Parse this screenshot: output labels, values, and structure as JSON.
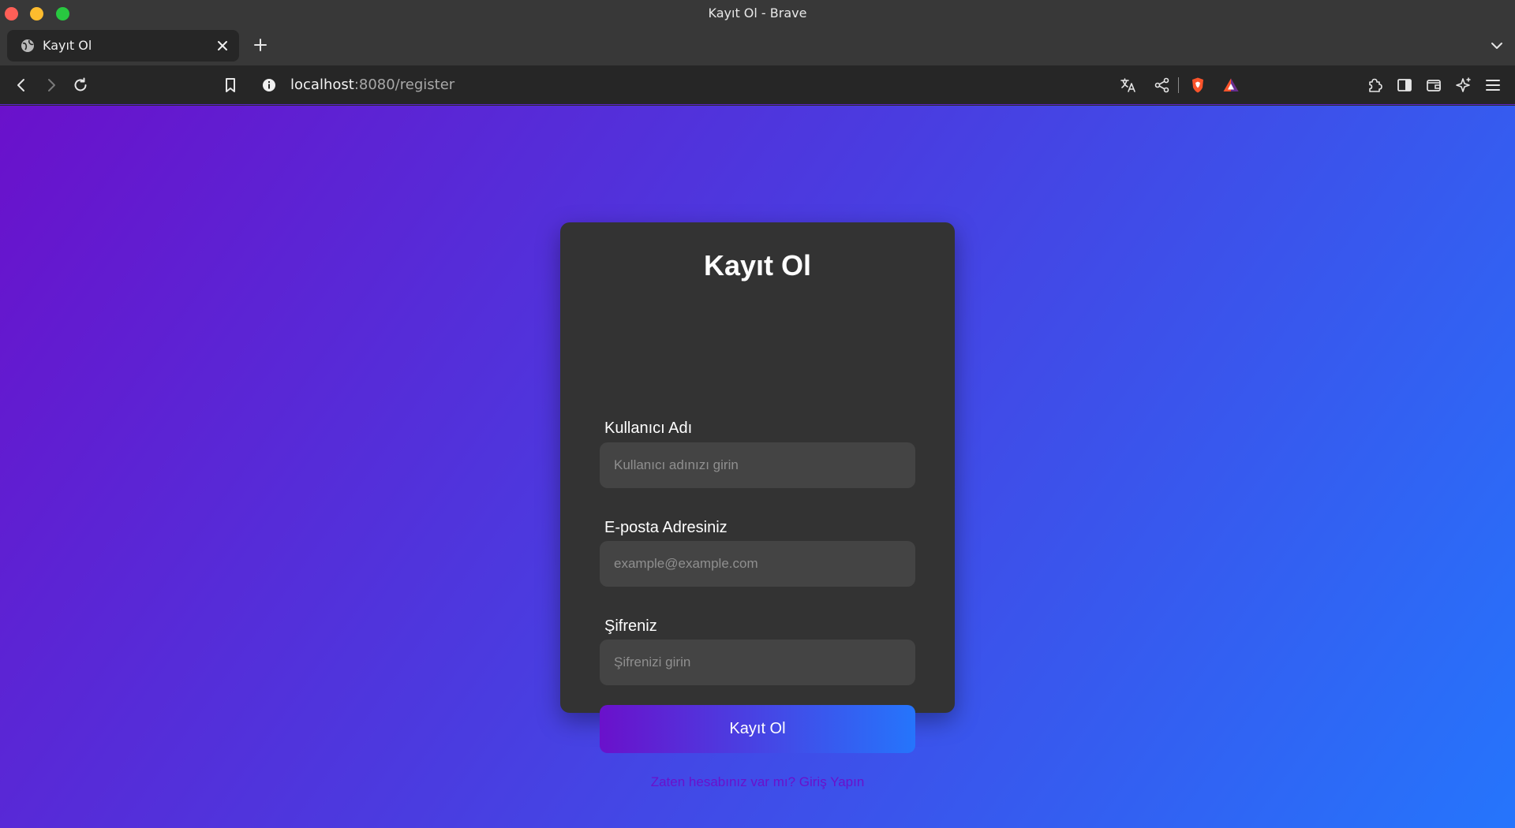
{
  "window": {
    "title": "Kayıt Ol - Brave"
  },
  "tabs": [
    {
      "title": "Kayıt Ol"
    }
  ],
  "toolbar": {
    "url_host": "localhost",
    "url_path": ":8080/register"
  },
  "icons": {
    "tab": [
      "globe-icon",
      "close-icon"
    ],
    "tabstrip": [
      "plus-icon",
      "chevron-down-icon"
    ],
    "nav": [
      "back-arrow-icon",
      "forward-arrow-icon",
      "reload-icon",
      "bookmark-icon",
      "info-icon"
    ],
    "right": [
      "translate-icon",
      "share-icon",
      "brave-shield-icon",
      "brave-rewards-icon",
      "extensions-icon",
      "sidebar-icon",
      "wallet-icon",
      "leo-ai-icon",
      "menu-icon"
    ]
  },
  "colors": {
    "gradient_start": "#6a11cb",
    "gradient_end": "#2575fc",
    "card_bg": "#333333",
    "input_bg": "#444444",
    "link": "#6a11cb"
  },
  "form": {
    "title": "Kayıt Ol",
    "username_label": "Kullanıcı Adı",
    "username_placeholder": "Kullanıcı adınızı girin",
    "email_label": "E-posta Adresiniz",
    "email_placeholder": "example@example.com",
    "password_label": "Şifreniz",
    "password_placeholder": "Şifrenizi girin",
    "submit_label": "Kayıt Ol",
    "login_link": "Zaten hesabınız var mı? Giriş Yapın"
  }
}
